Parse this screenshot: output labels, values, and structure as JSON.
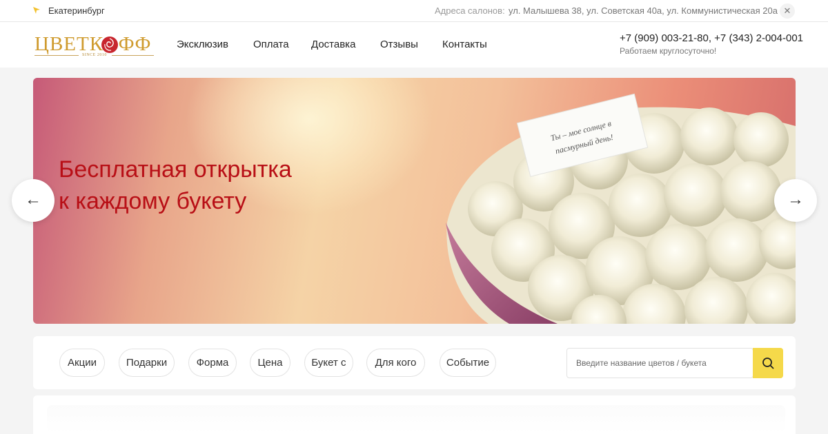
{
  "topbar": {
    "city": "Екатеринбург",
    "address_label": "Адреса салонов:",
    "addresses": "ул. Малышева 38, ул. Советская 40а, ул. Коммунистическая 20а",
    "close": "✕"
  },
  "header": {
    "logo_text": "ЦВЕТКОФФ",
    "logo_since": "SINCE 2010",
    "nav": [
      "Эксклюзив",
      "Оплата",
      "Доставка",
      "Отзывы",
      "Контакты"
    ],
    "phones": "+7 (909) 003-21-80, +7 (343) 2-004-001",
    "hours": "Работаем круглосуточно!"
  },
  "banner": {
    "title_line1": "Бесплатная открытка",
    "title_line2": "к каждому букету",
    "card_text_line1": "Ты – мое солнце в",
    "card_text_line2": "пасмурный день!",
    "prev": "←",
    "next": "→"
  },
  "filters": {
    "chips": [
      "Акции",
      "Подарки",
      "Форма",
      "Цена",
      "Букет с",
      "Для кого",
      "Событие"
    ],
    "search_placeholder": "Введите название цветов / букета"
  },
  "colors": {
    "accent_yellow": "#f5d94a",
    "banner_title": "#b80f16",
    "logo_gold": "#cf9b2e"
  },
  "icons": {
    "city": "location-arrow-icon",
    "search": "search-icon",
    "close": "close-icon"
  }
}
